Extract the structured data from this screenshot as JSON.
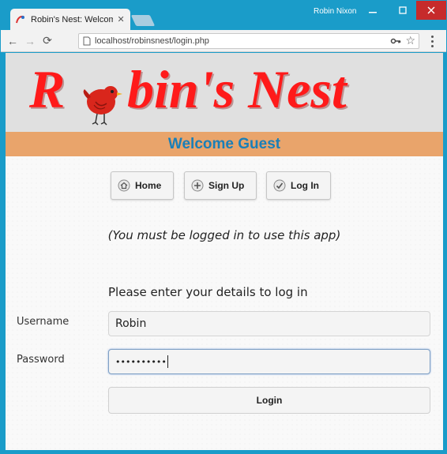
{
  "browser": {
    "tab_title": "Robin's Nest: Welcome G",
    "user_name": "Robin Nixon",
    "url": "localhost/robinsnest/login.php"
  },
  "site": {
    "logo_first_letter": "R",
    "logo_rest": "bin's Nest",
    "welcome": "Welcome Guest"
  },
  "nav": {
    "home": "Home",
    "signup": "Sign Up",
    "login": "Log In"
  },
  "notice": "(You must be logged in to use this app)",
  "form": {
    "heading": "Please enter your details to log in",
    "username_label": "Username",
    "username_value": "Robin",
    "password_label": "Password",
    "password_masked": "••••••••••",
    "submit": "Login"
  },
  "colors": {
    "title_bar": "#1a9cc9",
    "logo": "#ff1a1a",
    "welcome_bar": "#e9a46b",
    "welcome_text": "#1a7fb8"
  },
  "icons": [
    "tab-favicon",
    "close-icon",
    "minimize-icon",
    "maximize-icon",
    "back-icon",
    "forward-icon",
    "reload-icon",
    "page-icon",
    "key-icon",
    "star-icon",
    "menu-icon",
    "home-icon",
    "signup-icon",
    "login-icon"
  ]
}
